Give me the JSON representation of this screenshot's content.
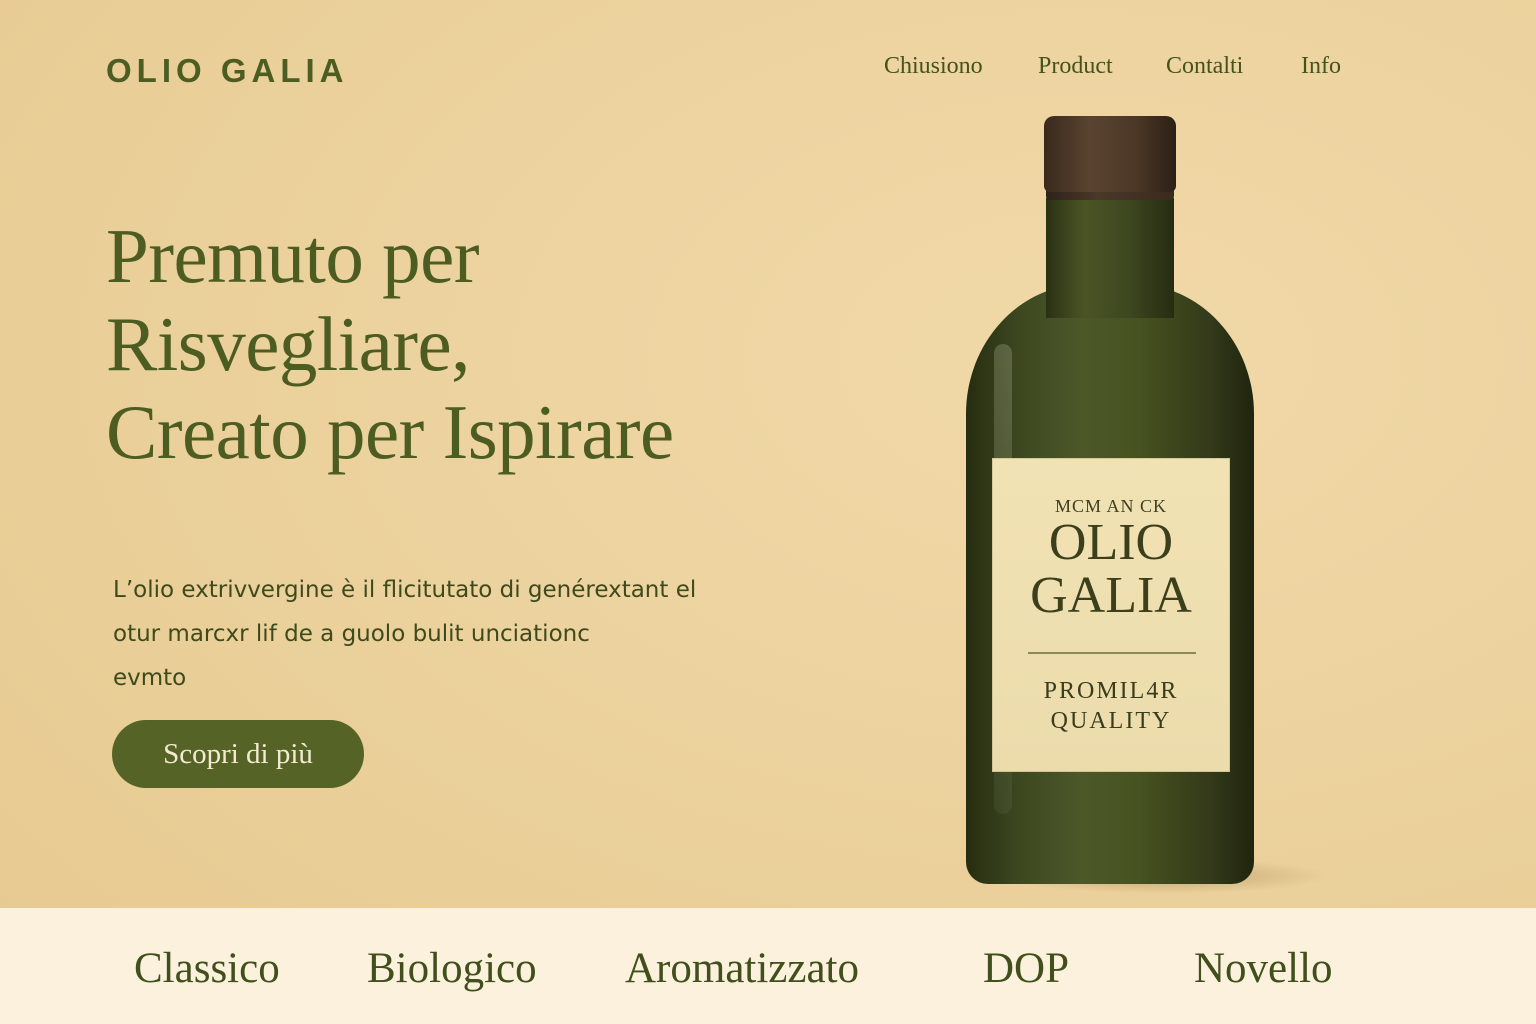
{
  "brand": {
    "logo_text": "OLIO GALIA"
  },
  "nav": {
    "items": [
      {
        "label": "Chiusiono"
      },
      {
        "label": "Product"
      },
      {
        "label": "Contalti"
      },
      {
        "label": "Info"
      }
    ]
  },
  "hero": {
    "title_lines": [
      "Premuto per",
      "Risvegliare,",
      "Creato per Ispirare"
    ],
    "body_lines": [
      "L’olio extrivvergine è il flicitutato di genérextant el",
      "otur marcxr lif de a guolo bulit unciationc",
      "evmto"
    ],
    "cta_label": "Scopri di più"
  },
  "product_label": {
    "top_text": "MCM AN CK",
    "brand_lines": [
      "OLIO",
      "GALIA"
    ],
    "quality_lines": [
      "PROMIL4R",
      "QUALITY"
    ]
  },
  "categories": {
    "items": [
      {
        "label": "Classico"
      },
      {
        "label": "Biologico"
      },
      {
        "label": "Aromatizzato"
      },
      {
        "label": "DOP"
      },
      {
        "label": "Novello"
      }
    ]
  },
  "colors": {
    "background": "#ecd29e",
    "primary_green": "#4d5d22",
    "button": "#566327",
    "category_bar": "#fbf1dc",
    "bottle_cap": "#4b3726",
    "label_paper": "#f1e2b4"
  }
}
